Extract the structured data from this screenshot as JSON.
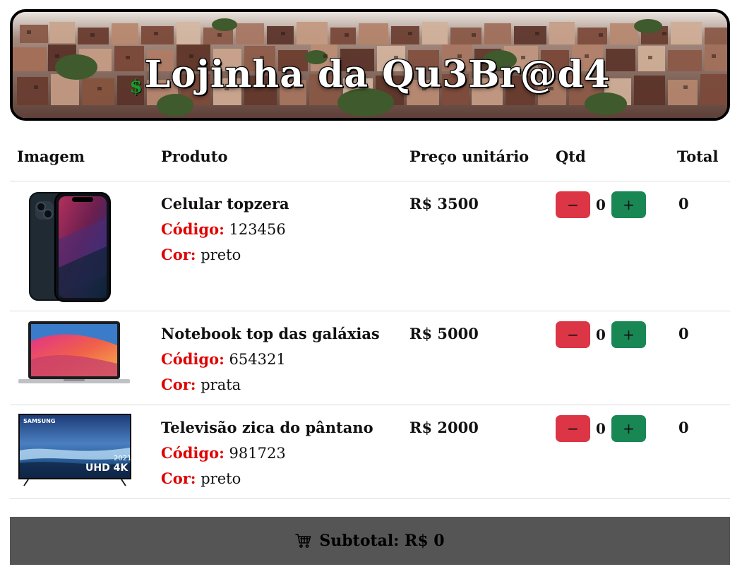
{
  "header": {
    "currency_symbol": "$",
    "title": "Lojinha da Qu3Br@d4"
  },
  "table": {
    "columns": {
      "image": "Imagem",
      "product": "Produto",
      "unit_price": "Preço unitário",
      "qty": "Qtd",
      "total": "Total"
    },
    "code_label": "Código:",
    "color_label": "Cor:",
    "minus_label": "−",
    "plus_label": "+",
    "rows": [
      {
        "name": "Celular topzera",
        "code": "123456",
        "color": "preto",
        "price": "R$ 3500",
        "qty": "0",
        "total": "0",
        "image": "smartphone-image"
      },
      {
        "name": "Notebook top das galáxias",
        "code": "654321",
        "color": "prata",
        "price": "R$ 5000",
        "qty": "0",
        "total": "0",
        "image": "laptop-image"
      },
      {
        "name": "Televisão zica do pântano",
        "code": "981723",
        "color": "preto",
        "price": "R$ 2000",
        "qty": "0",
        "total": "0",
        "image": "tv-image",
        "tv_brand": "SAMSUNG",
        "tv_year": "2021",
        "tv_model": "UHD 4K"
      }
    ]
  },
  "footer": {
    "subtotal": "Subtotal: R$ 0",
    "icon": "cart-icon"
  },
  "colors": {
    "minus_button": "#dc3545",
    "plus_button": "#198754",
    "label_red": "#e00000",
    "subtotal_bg": "#555555"
  }
}
